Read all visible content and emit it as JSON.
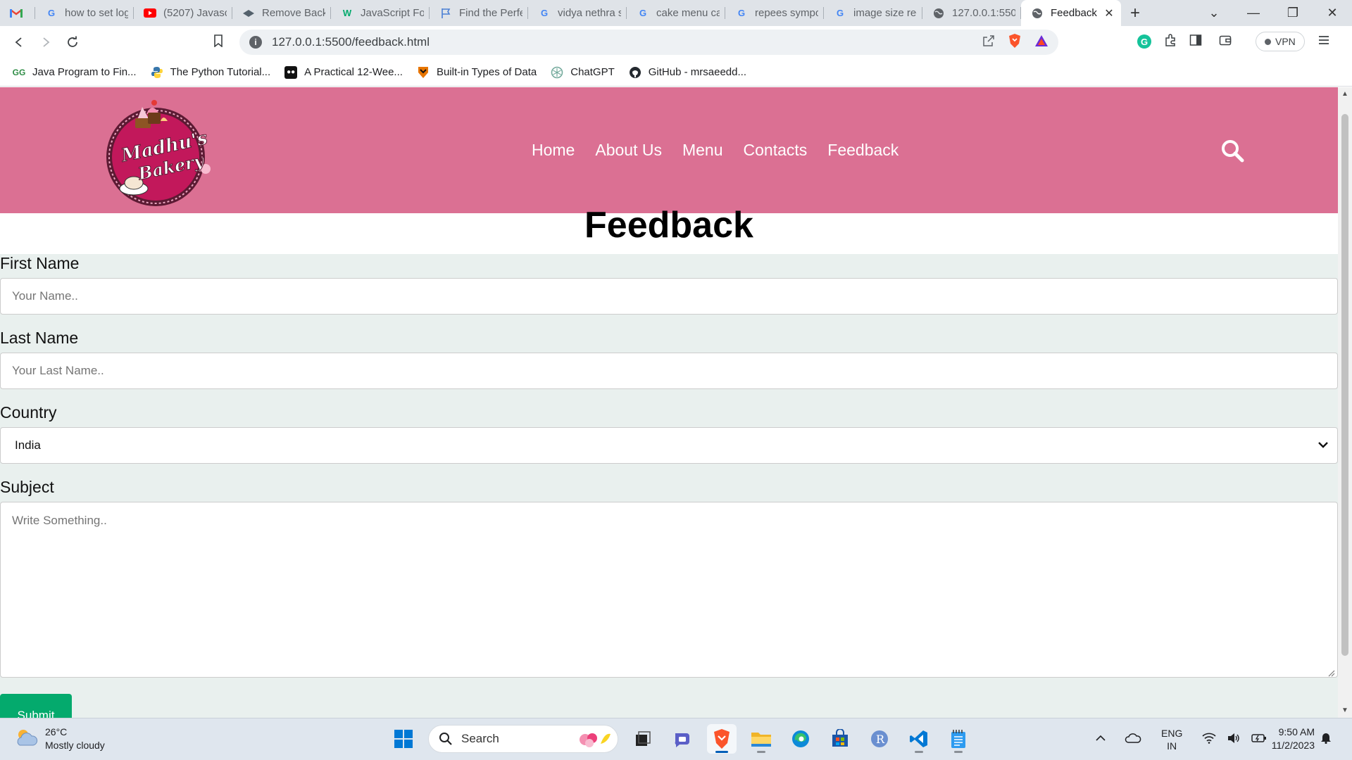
{
  "browser": {
    "tabs": [
      {
        "title": "",
        "favicon": "gmail-icon",
        "active": false
      },
      {
        "title": "how to set log",
        "favicon": "google-icon",
        "active": false
      },
      {
        "title": "(5207) Javascr",
        "favicon": "youtube-icon",
        "active": false
      },
      {
        "title": "Remove Backg",
        "favicon": "removebg-icon",
        "active": false
      },
      {
        "title": "JavaScript For",
        "favicon": "w3-icon",
        "active": false
      },
      {
        "title": "Find the Perfe",
        "favicon": "flag-icon",
        "active": false
      },
      {
        "title": "vidya nethra s",
        "favicon": "google-icon",
        "active": false
      },
      {
        "title": "cake menu ca",
        "favicon": "google-icon",
        "active": false
      },
      {
        "title": "repees sympo",
        "favicon": "google-icon",
        "active": false
      },
      {
        "title": "image size rec",
        "favicon": "google-icon",
        "active": false
      },
      {
        "title": "127.0.0.1:5500",
        "favicon": "globe-icon",
        "active": false
      },
      {
        "title": "Feedback",
        "favicon": "globe-icon",
        "active": true
      }
    ],
    "url": "127.0.0.1:5500/feedback.html",
    "vpn_label": "VPN",
    "bookmarks": [
      {
        "label": "Java Program to Fin...",
        "icon": "gfg-icon"
      },
      {
        "label": "The Python Tutorial...",
        "icon": "python-icon"
      },
      {
        "label": "A Practical 12-Wee...",
        "icon": "medium-icon"
      },
      {
        "label": "Built-in Types of Data",
        "icon": "princeton-icon"
      },
      {
        "label": "ChatGPT",
        "icon": "chatgpt-icon"
      },
      {
        "label": "GitHub - mrsaeedd...",
        "icon": "github-icon"
      }
    ]
  },
  "site": {
    "brand_color": "#db7093",
    "logo_text": "Madhu's Bakery",
    "nav": [
      "Home",
      "About Us",
      "Menu",
      "Contacts",
      "Feedback"
    ],
    "page_title": "Feedback",
    "form": {
      "first_name_label": "First Name",
      "first_name_placeholder": "Your Name..",
      "last_name_label": "Last Name",
      "last_name_placeholder": "Your Last Name..",
      "country_label": "Country",
      "country_value": "India",
      "subject_label": "Subject",
      "subject_placeholder": "Write Something..",
      "submit_label": "Submit",
      "submit_color": "#04aa6d"
    }
  },
  "taskbar": {
    "weather_temp": "26°C",
    "weather_desc": "Mostly cloudy",
    "search_label": "Search",
    "lang_line1": "ENG",
    "lang_line2": "IN",
    "time": "9:50 AM",
    "date": "11/2/2023"
  }
}
